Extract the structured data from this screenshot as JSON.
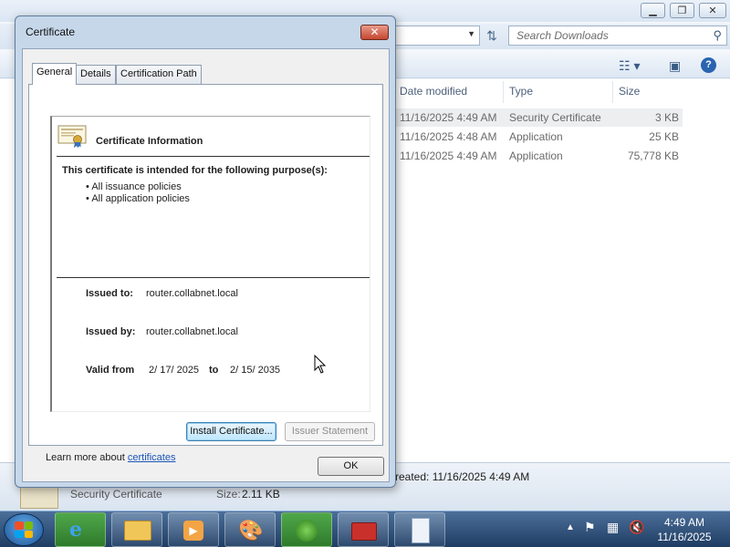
{
  "explorer": {
    "search_placeholder": "Search Downloads",
    "columns": [
      "Date modified",
      "Type",
      "Size"
    ],
    "files": [
      {
        "date": "11/16/2025 4:49 AM",
        "type": "Security Certificate",
        "size": "3 KB"
      },
      {
        "date": "11/16/2025 4:48 AM",
        "type": "Application",
        "size": "25 KB"
      },
      {
        "date": "11/16/2025 4:49 AM",
        "type": "Application",
        "size": "75,778 KB"
      }
    ],
    "status": {
      "created": "reated: 11/16/2025 4:49 AM",
      "file_type": "Security Certificate",
      "size_label": "Size:",
      "size_value": "2.11 KB"
    }
  },
  "dialog": {
    "title": "Certificate",
    "tabs": [
      "General",
      "Details",
      "Certification Path"
    ],
    "info_title": "Certificate Information",
    "purpose_heading": "This certificate is intended for the following purpose(s):",
    "purposes": [
      "All issuance policies",
      "All application policies"
    ],
    "issued_to_label": "Issued to:",
    "issued_to": "router.collabnet.local",
    "issued_by_label": "Issued by:",
    "issued_by": "router.collabnet.local",
    "valid_from_label": "Valid from",
    "valid_from": "2/ 17/ 2025",
    "to_label": "to",
    "valid_to": "2/ 15/ 2035",
    "install_button": "Install Certificate...",
    "issuer_button": "Issuer Statement",
    "learn_more": "Learn more about",
    "learn_link": "certificates",
    "ok_button": "OK"
  },
  "taskbar": {
    "time": "4:49 AM",
    "date": "11/16/2025"
  },
  "colors": {
    "dialog_frame": "#c6d7ea",
    "link": "#1a55b8",
    "taskbar": "#2a4a74",
    "close_button": "#c4472f"
  }
}
